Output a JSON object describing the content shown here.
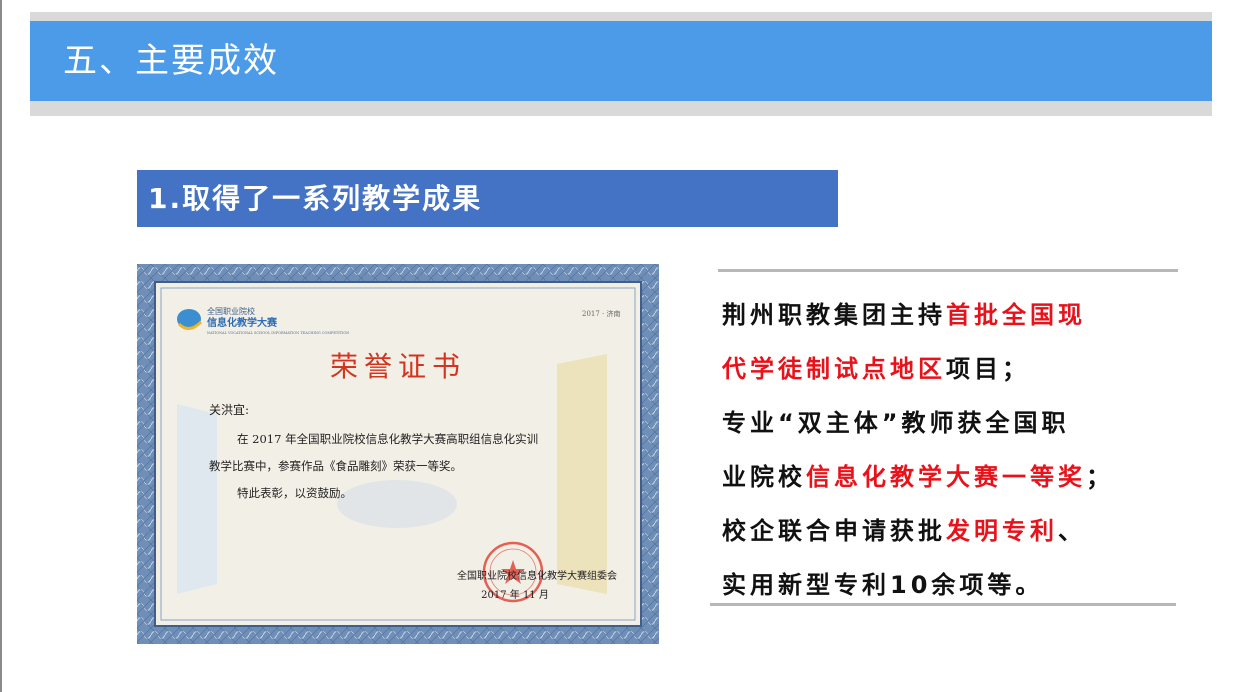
{
  "header": {
    "title": "五、主要成效"
  },
  "section": {
    "title": "1.取得了一系列教学成果"
  },
  "certificate": {
    "logo_line1": "全国职业院校",
    "logo_line2": "信息化教学大赛",
    "logo_en": "NATIONAL VOCATIONAL SCHOOL INFORMATION TEACHING COMPETITION",
    "corner": "2017 · 济南",
    "title": "荣誉证书",
    "recipient": "关洪宜:",
    "body1": "在 2017 年全国职业院校信息化教学大赛高职组信息化实训",
    "body2": "教学比赛中，参赛作品《食品雕刻》荣获一等奖。",
    "body3": "特此表彰，以资鼓励。",
    "issuer": "全国职业院校信息化教学大赛组委会",
    "date": "2017 年 11 月"
  },
  "achievements": {
    "l1a": "荆州职教集团主持",
    "l1b": "首批全国现",
    "l2a": "代学徒制试点地区",
    "l2b": "项目；",
    "l3": "专业“双主体”教师获全国职",
    "l4a": "业院校",
    "l4b": "信息化教学大赛一等奖",
    "l4c": "；",
    "l5a": "校企联合申请获批",
    "l5b": "发明专利",
    "l5c": "、",
    "l6": "实用新型专利10余项等。"
  },
  "colors": {
    "header": "#4c9be8",
    "section": "#4472c4",
    "highlight": "#e8121b",
    "certificate_title": "#d2351f"
  }
}
